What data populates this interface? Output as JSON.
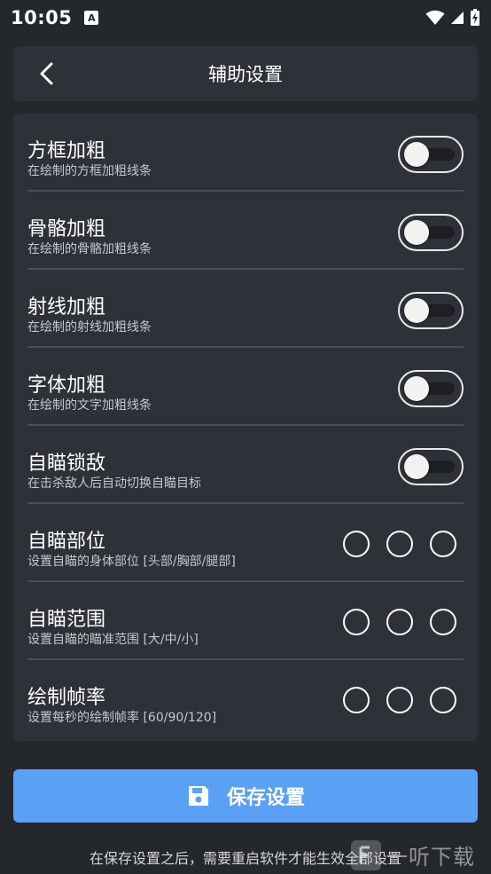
{
  "status": {
    "time": "10:05",
    "notification_letter": "A"
  },
  "header": {
    "title": "辅助设置"
  },
  "settings": [
    {
      "title": "方框加粗",
      "subtitle": "在绘制的方框加粗线条",
      "control": "switch",
      "on": false
    },
    {
      "title": "骨骼加粗",
      "subtitle": "在绘制的骨骼加粗线条",
      "control": "switch",
      "on": false
    },
    {
      "title": "射线加粗",
      "subtitle": "在绘制的射线加粗线条",
      "control": "switch",
      "on": false
    },
    {
      "title": "字体加粗",
      "subtitle": "在绘制的文字加粗线条",
      "control": "switch",
      "on": false
    },
    {
      "title": "自瞄锁敌",
      "subtitle": "在击杀敌人后自动切换自瞄目标",
      "control": "switch",
      "on": false
    },
    {
      "title": "自瞄部位",
      "subtitle": "设置自瞄的身体部位 [头部/胸部/腿部]",
      "control": "radio",
      "options": 3
    },
    {
      "title": "自瞄范围",
      "subtitle": "设置自瞄的瞄准范围 [大/中/小]",
      "control": "radio",
      "options": 3
    },
    {
      "title": "绘制帧率",
      "subtitle": "设置每秒的绘制帧率 [60/90/120]",
      "control": "radio",
      "options": 3
    }
  ],
  "save_button": {
    "label": "保存设置",
    "icon": "save-icon",
    "color": "#5aa0f5"
  },
  "footer_note": "在保存设置之后，需要重启软件才能生效全部设置",
  "watermark": {
    "text": "一听下载"
  },
  "colors": {
    "background": "#24272c",
    "card": "#2e3137",
    "divider": "#4a4e55"
  }
}
